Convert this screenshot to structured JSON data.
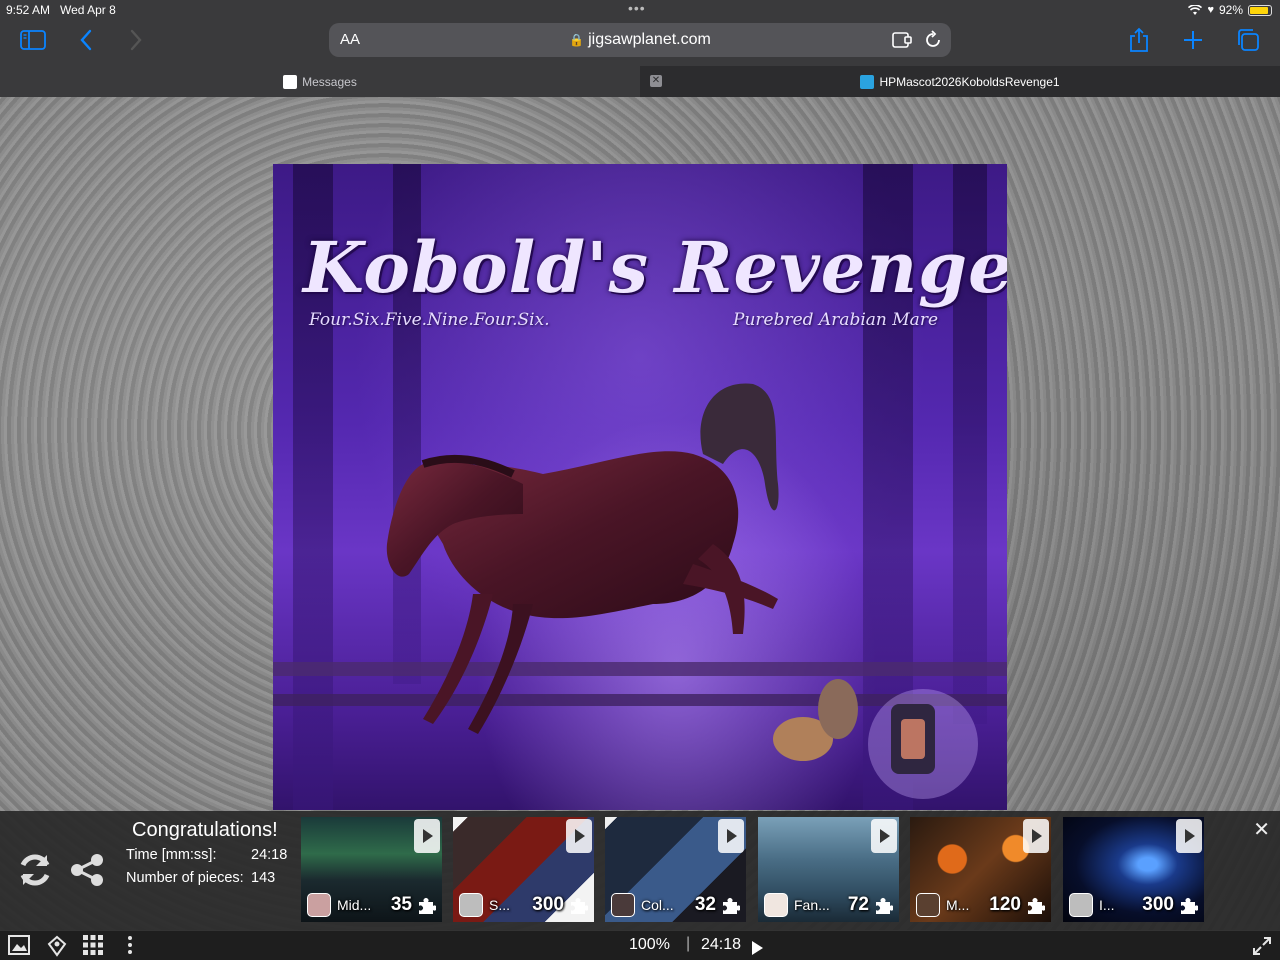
{
  "status_bar": {
    "time": "9:52 AM",
    "date": "Wed Apr 8",
    "battery": "92%"
  },
  "browser": {
    "address_text_size": "AA",
    "url": "jigsawplanet.com",
    "tabs": [
      {
        "label": "Messages",
        "active": false
      },
      {
        "label": "HPMascot2026KoboldsRevenge1",
        "active": true
      }
    ]
  },
  "puzzle": {
    "title": "Kobold's Revenge",
    "subtitle_left": "Four.Six.Five.Nine.Four.Six.",
    "subtitle_right": "Purebred Arabian Mare"
  },
  "completion": {
    "heading": "Congratulations!",
    "time_label": "Time [mm:ss]:",
    "time_value": "24:18",
    "pieces_label": "Number of pieces:",
    "pieces_value": "143"
  },
  "suggestions": [
    {
      "name": "Mid...",
      "count": "35"
    },
    {
      "name": "S...",
      "count": "300"
    },
    {
      "name": "Col...",
      "count": "32"
    },
    {
      "name": "Fan...",
      "count": "72"
    },
    {
      "name": "M...",
      "count": "120"
    },
    {
      "name": "I...",
      "count": "300"
    }
  ],
  "bottom_bar": {
    "zoom": "100%",
    "separator": "|",
    "timer": "24:18"
  },
  "colors": {
    "accent": "#0a84ff",
    "puzzle_purple": "#5428b0",
    "battery": "#ffd60a"
  }
}
